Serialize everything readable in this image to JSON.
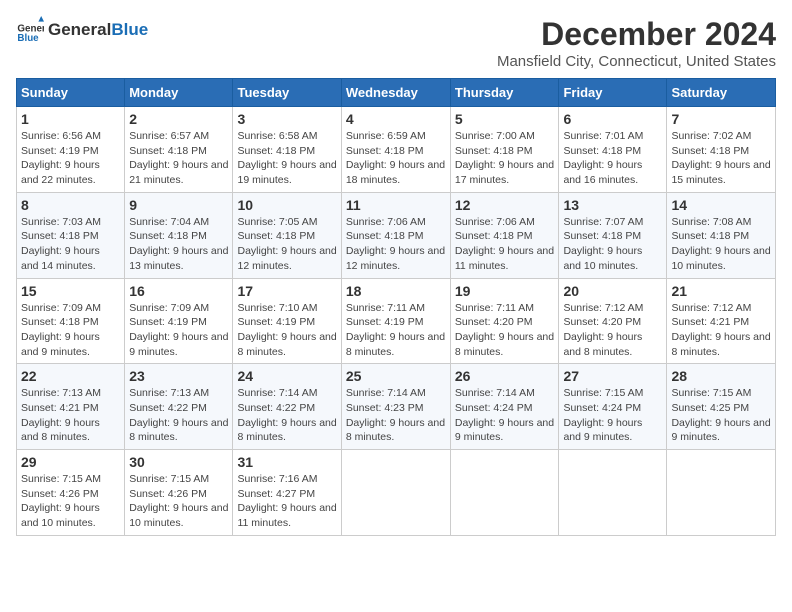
{
  "logo": {
    "general": "General",
    "blue": "Blue"
  },
  "title": "December 2024",
  "subtitle": "Mansfield City, Connecticut, United States",
  "days_of_week": [
    "Sunday",
    "Monday",
    "Tuesday",
    "Wednesday",
    "Thursday",
    "Friday",
    "Saturday"
  ],
  "weeks": [
    [
      {
        "day": "1",
        "sunrise": "Sunrise: 6:56 AM",
        "sunset": "Sunset: 4:19 PM",
        "daylight": "Daylight: 9 hours and 22 minutes."
      },
      {
        "day": "2",
        "sunrise": "Sunrise: 6:57 AM",
        "sunset": "Sunset: 4:18 PM",
        "daylight": "Daylight: 9 hours and 21 minutes."
      },
      {
        "day": "3",
        "sunrise": "Sunrise: 6:58 AM",
        "sunset": "Sunset: 4:18 PM",
        "daylight": "Daylight: 9 hours and 19 minutes."
      },
      {
        "day": "4",
        "sunrise": "Sunrise: 6:59 AM",
        "sunset": "Sunset: 4:18 PM",
        "daylight": "Daylight: 9 hours and 18 minutes."
      },
      {
        "day": "5",
        "sunrise": "Sunrise: 7:00 AM",
        "sunset": "Sunset: 4:18 PM",
        "daylight": "Daylight: 9 hours and 17 minutes."
      },
      {
        "day": "6",
        "sunrise": "Sunrise: 7:01 AM",
        "sunset": "Sunset: 4:18 PM",
        "daylight": "Daylight: 9 hours and 16 minutes."
      },
      {
        "day": "7",
        "sunrise": "Sunrise: 7:02 AM",
        "sunset": "Sunset: 4:18 PM",
        "daylight": "Daylight: 9 hours and 15 minutes."
      }
    ],
    [
      {
        "day": "8",
        "sunrise": "Sunrise: 7:03 AM",
        "sunset": "Sunset: 4:18 PM",
        "daylight": "Daylight: 9 hours and 14 minutes."
      },
      {
        "day": "9",
        "sunrise": "Sunrise: 7:04 AM",
        "sunset": "Sunset: 4:18 PM",
        "daylight": "Daylight: 9 hours and 13 minutes."
      },
      {
        "day": "10",
        "sunrise": "Sunrise: 7:05 AM",
        "sunset": "Sunset: 4:18 PM",
        "daylight": "Daylight: 9 hours and 12 minutes."
      },
      {
        "day": "11",
        "sunrise": "Sunrise: 7:06 AM",
        "sunset": "Sunset: 4:18 PM",
        "daylight": "Daylight: 9 hours and 12 minutes."
      },
      {
        "day": "12",
        "sunrise": "Sunrise: 7:06 AM",
        "sunset": "Sunset: 4:18 PM",
        "daylight": "Daylight: 9 hours and 11 minutes."
      },
      {
        "day": "13",
        "sunrise": "Sunrise: 7:07 AM",
        "sunset": "Sunset: 4:18 PM",
        "daylight": "Daylight: 9 hours and 10 minutes."
      },
      {
        "day": "14",
        "sunrise": "Sunrise: 7:08 AM",
        "sunset": "Sunset: 4:18 PM",
        "daylight": "Daylight: 9 hours and 10 minutes."
      }
    ],
    [
      {
        "day": "15",
        "sunrise": "Sunrise: 7:09 AM",
        "sunset": "Sunset: 4:18 PM",
        "daylight": "Daylight: 9 hours and 9 minutes."
      },
      {
        "day": "16",
        "sunrise": "Sunrise: 7:09 AM",
        "sunset": "Sunset: 4:19 PM",
        "daylight": "Daylight: 9 hours and 9 minutes."
      },
      {
        "day": "17",
        "sunrise": "Sunrise: 7:10 AM",
        "sunset": "Sunset: 4:19 PM",
        "daylight": "Daylight: 9 hours and 8 minutes."
      },
      {
        "day": "18",
        "sunrise": "Sunrise: 7:11 AM",
        "sunset": "Sunset: 4:19 PM",
        "daylight": "Daylight: 9 hours and 8 minutes."
      },
      {
        "day": "19",
        "sunrise": "Sunrise: 7:11 AM",
        "sunset": "Sunset: 4:20 PM",
        "daylight": "Daylight: 9 hours and 8 minutes."
      },
      {
        "day": "20",
        "sunrise": "Sunrise: 7:12 AM",
        "sunset": "Sunset: 4:20 PM",
        "daylight": "Daylight: 9 hours and 8 minutes."
      },
      {
        "day": "21",
        "sunrise": "Sunrise: 7:12 AM",
        "sunset": "Sunset: 4:21 PM",
        "daylight": "Daylight: 9 hours and 8 minutes."
      }
    ],
    [
      {
        "day": "22",
        "sunrise": "Sunrise: 7:13 AM",
        "sunset": "Sunset: 4:21 PM",
        "daylight": "Daylight: 9 hours and 8 minutes."
      },
      {
        "day": "23",
        "sunrise": "Sunrise: 7:13 AM",
        "sunset": "Sunset: 4:22 PM",
        "daylight": "Daylight: 9 hours and 8 minutes."
      },
      {
        "day": "24",
        "sunrise": "Sunrise: 7:14 AM",
        "sunset": "Sunset: 4:22 PM",
        "daylight": "Daylight: 9 hours and 8 minutes."
      },
      {
        "day": "25",
        "sunrise": "Sunrise: 7:14 AM",
        "sunset": "Sunset: 4:23 PM",
        "daylight": "Daylight: 9 hours and 8 minutes."
      },
      {
        "day": "26",
        "sunrise": "Sunrise: 7:14 AM",
        "sunset": "Sunset: 4:24 PM",
        "daylight": "Daylight: 9 hours and 9 minutes."
      },
      {
        "day": "27",
        "sunrise": "Sunrise: 7:15 AM",
        "sunset": "Sunset: 4:24 PM",
        "daylight": "Daylight: 9 hours and 9 minutes."
      },
      {
        "day": "28",
        "sunrise": "Sunrise: 7:15 AM",
        "sunset": "Sunset: 4:25 PM",
        "daylight": "Daylight: 9 hours and 9 minutes."
      }
    ],
    [
      {
        "day": "29",
        "sunrise": "Sunrise: 7:15 AM",
        "sunset": "Sunset: 4:26 PM",
        "daylight": "Daylight: 9 hours and 10 minutes."
      },
      {
        "day": "30",
        "sunrise": "Sunrise: 7:15 AM",
        "sunset": "Sunset: 4:26 PM",
        "daylight": "Daylight: 9 hours and 10 minutes."
      },
      {
        "day": "31",
        "sunrise": "Sunrise: 7:16 AM",
        "sunset": "Sunset: 4:27 PM",
        "daylight": "Daylight: 9 hours and 11 minutes."
      },
      null,
      null,
      null,
      null
    ]
  ]
}
